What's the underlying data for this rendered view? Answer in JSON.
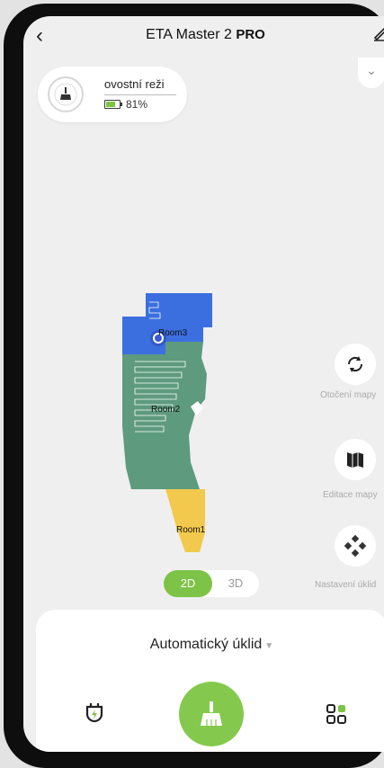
{
  "header": {
    "title_main": "ETA Master 2",
    "title_badge": "PRO",
    "back_icon": "chevron-left-icon",
    "edit_icon": "edit-pen-icon"
  },
  "status": {
    "mode_label": "ovostní reži",
    "battery_percent": "81%",
    "battery_level": 0.81,
    "icon": "vacuum-brush-icon"
  },
  "map": {
    "rooms": [
      {
        "name": "Room3",
        "color": "#3b6fe0"
      },
      {
        "name": "Room2",
        "color": "#5e9a7e"
      },
      {
        "name": "Room1",
        "color": "#f2c94c"
      }
    ]
  },
  "side_actions": [
    {
      "label": "Otočení mapy",
      "icon": "rotate-icon"
    },
    {
      "label": "Editace mapy",
      "icon": "map-icon"
    },
    {
      "label": "Nastavení úklid",
      "icon": "diamond-grid-icon"
    }
  ],
  "view_toggle": {
    "option_2d": "2D",
    "option_3d": "3D",
    "selected": "2D"
  },
  "bottom_panel": {
    "mode_select": "Automatický úklid",
    "left_icon": "shield-plug-icon",
    "center_icon": "broom-icon",
    "right_icon": "apps-grid-icon"
  },
  "colors": {
    "accent": "#7cc347"
  }
}
